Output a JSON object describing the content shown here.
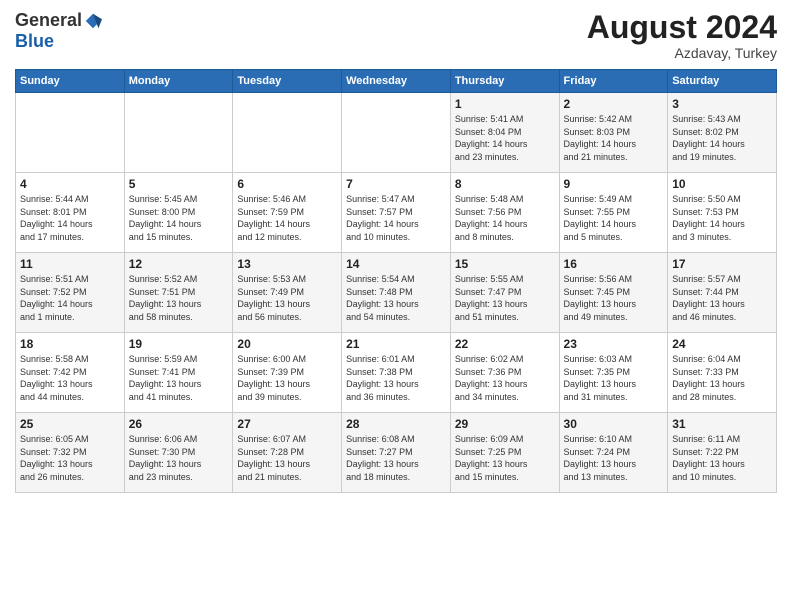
{
  "logo": {
    "general": "General",
    "blue": "Blue"
  },
  "title": "August 2024",
  "location": "Azdavay, Turkey",
  "weekdays": [
    "Sunday",
    "Monday",
    "Tuesday",
    "Wednesday",
    "Thursday",
    "Friday",
    "Saturday"
  ],
  "weeks": [
    [
      {
        "day": "",
        "info": ""
      },
      {
        "day": "",
        "info": ""
      },
      {
        "day": "",
        "info": ""
      },
      {
        "day": "",
        "info": ""
      },
      {
        "day": "1",
        "info": "Sunrise: 5:41 AM\nSunset: 8:04 PM\nDaylight: 14 hours\nand 23 minutes."
      },
      {
        "day": "2",
        "info": "Sunrise: 5:42 AM\nSunset: 8:03 PM\nDaylight: 14 hours\nand 21 minutes."
      },
      {
        "day": "3",
        "info": "Sunrise: 5:43 AM\nSunset: 8:02 PM\nDaylight: 14 hours\nand 19 minutes."
      }
    ],
    [
      {
        "day": "4",
        "info": "Sunrise: 5:44 AM\nSunset: 8:01 PM\nDaylight: 14 hours\nand 17 minutes."
      },
      {
        "day": "5",
        "info": "Sunrise: 5:45 AM\nSunset: 8:00 PM\nDaylight: 14 hours\nand 15 minutes."
      },
      {
        "day": "6",
        "info": "Sunrise: 5:46 AM\nSunset: 7:59 PM\nDaylight: 14 hours\nand 12 minutes."
      },
      {
        "day": "7",
        "info": "Sunrise: 5:47 AM\nSunset: 7:57 PM\nDaylight: 14 hours\nand 10 minutes."
      },
      {
        "day": "8",
        "info": "Sunrise: 5:48 AM\nSunset: 7:56 PM\nDaylight: 14 hours\nand 8 minutes."
      },
      {
        "day": "9",
        "info": "Sunrise: 5:49 AM\nSunset: 7:55 PM\nDaylight: 14 hours\nand 5 minutes."
      },
      {
        "day": "10",
        "info": "Sunrise: 5:50 AM\nSunset: 7:53 PM\nDaylight: 14 hours\nand 3 minutes."
      }
    ],
    [
      {
        "day": "11",
        "info": "Sunrise: 5:51 AM\nSunset: 7:52 PM\nDaylight: 14 hours\nand 1 minute."
      },
      {
        "day": "12",
        "info": "Sunrise: 5:52 AM\nSunset: 7:51 PM\nDaylight: 13 hours\nand 58 minutes."
      },
      {
        "day": "13",
        "info": "Sunrise: 5:53 AM\nSunset: 7:49 PM\nDaylight: 13 hours\nand 56 minutes."
      },
      {
        "day": "14",
        "info": "Sunrise: 5:54 AM\nSunset: 7:48 PM\nDaylight: 13 hours\nand 54 minutes."
      },
      {
        "day": "15",
        "info": "Sunrise: 5:55 AM\nSunset: 7:47 PM\nDaylight: 13 hours\nand 51 minutes."
      },
      {
        "day": "16",
        "info": "Sunrise: 5:56 AM\nSunset: 7:45 PM\nDaylight: 13 hours\nand 49 minutes."
      },
      {
        "day": "17",
        "info": "Sunrise: 5:57 AM\nSunset: 7:44 PM\nDaylight: 13 hours\nand 46 minutes."
      }
    ],
    [
      {
        "day": "18",
        "info": "Sunrise: 5:58 AM\nSunset: 7:42 PM\nDaylight: 13 hours\nand 44 minutes."
      },
      {
        "day": "19",
        "info": "Sunrise: 5:59 AM\nSunset: 7:41 PM\nDaylight: 13 hours\nand 41 minutes."
      },
      {
        "day": "20",
        "info": "Sunrise: 6:00 AM\nSunset: 7:39 PM\nDaylight: 13 hours\nand 39 minutes."
      },
      {
        "day": "21",
        "info": "Sunrise: 6:01 AM\nSunset: 7:38 PM\nDaylight: 13 hours\nand 36 minutes."
      },
      {
        "day": "22",
        "info": "Sunrise: 6:02 AM\nSunset: 7:36 PM\nDaylight: 13 hours\nand 34 minutes."
      },
      {
        "day": "23",
        "info": "Sunrise: 6:03 AM\nSunset: 7:35 PM\nDaylight: 13 hours\nand 31 minutes."
      },
      {
        "day": "24",
        "info": "Sunrise: 6:04 AM\nSunset: 7:33 PM\nDaylight: 13 hours\nand 28 minutes."
      }
    ],
    [
      {
        "day": "25",
        "info": "Sunrise: 6:05 AM\nSunset: 7:32 PM\nDaylight: 13 hours\nand 26 minutes."
      },
      {
        "day": "26",
        "info": "Sunrise: 6:06 AM\nSunset: 7:30 PM\nDaylight: 13 hours\nand 23 minutes."
      },
      {
        "day": "27",
        "info": "Sunrise: 6:07 AM\nSunset: 7:28 PM\nDaylight: 13 hours\nand 21 minutes."
      },
      {
        "day": "28",
        "info": "Sunrise: 6:08 AM\nSunset: 7:27 PM\nDaylight: 13 hours\nand 18 minutes."
      },
      {
        "day": "29",
        "info": "Sunrise: 6:09 AM\nSunset: 7:25 PM\nDaylight: 13 hours\nand 15 minutes."
      },
      {
        "day": "30",
        "info": "Sunrise: 6:10 AM\nSunset: 7:24 PM\nDaylight: 13 hours\nand 13 minutes."
      },
      {
        "day": "31",
        "info": "Sunrise: 6:11 AM\nSunset: 7:22 PM\nDaylight: 13 hours\nand 10 minutes."
      }
    ]
  ]
}
